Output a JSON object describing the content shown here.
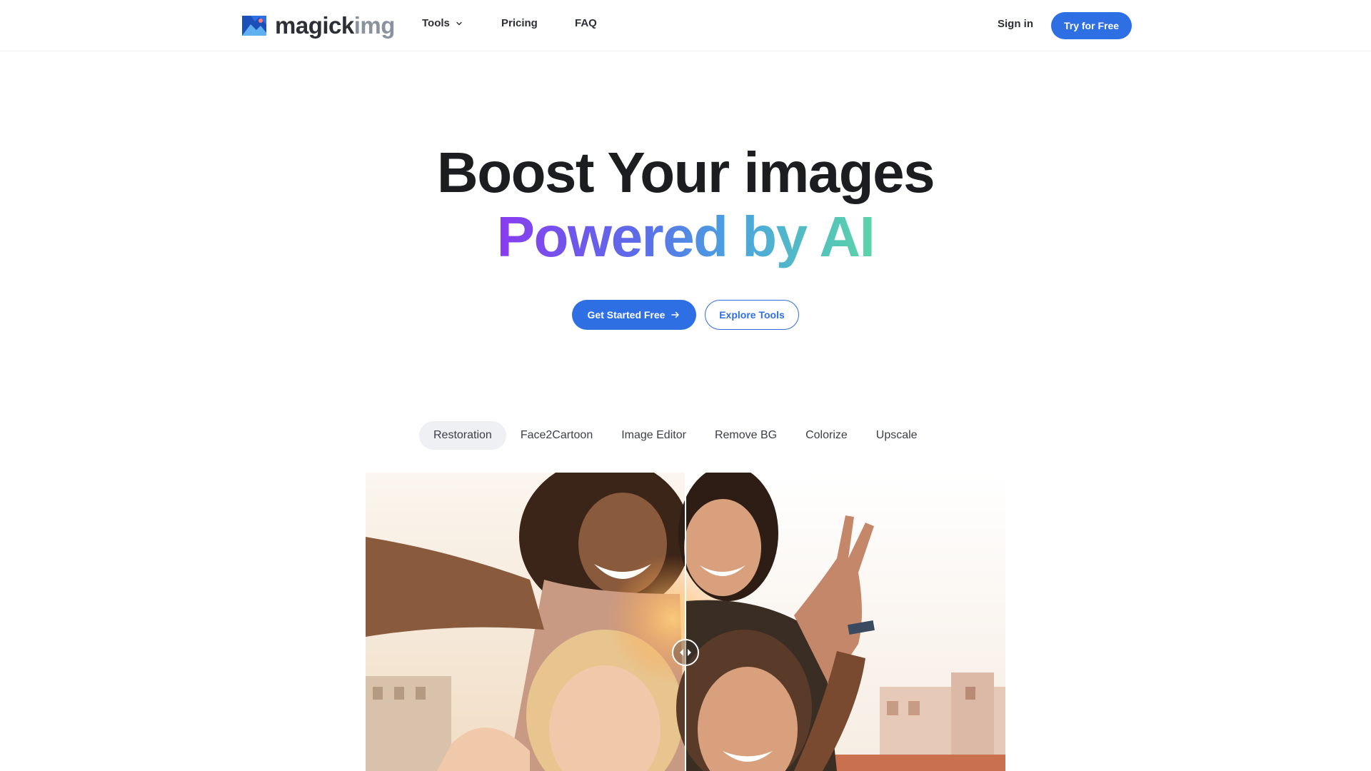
{
  "header": {
    "logo": {
      "brand_dark": "magick",
      "brand_light": "img",
      "icon": "mountain-flag-logo-icon"
    },
    "nav": [
      {
        "label": "Tools",
        "has_dropdown": true
      },
      {
        "label": "Pricing"
      },
      {
        "label": "FAQ"
      }
    ],
    "sign_in": "Sign in",
    "try_button": "Try for Free"
  },
  "hero": {
    "line1": "Boost Your images",
    "line2": "Powered by AI",
    "primary_cta": "Get Started Free",
    "primary_cta_icon": "arrow-right-icon",
    "secondary_cta": "Explore Tools"
  },
  "tabs": {
    "items": [
      "Restoration",
      "Face2Cartoon",
      "Image Editor",
      "Remove BG",
      "Colorize",
      "Upscale"
    ],
    "active": "Restoration"
  },
  "comparison": {
    "slider_position": 0.5,
    "handle_icon": "left-right-arrows-icon"
  },
  "colors": {
    "accent": "#2f6fe4",
    "gradient_start": "#8a3cf0",
    "gradient_mid": "#4aa3e0",
    "gradient_end": "#5cd4a8"
  }
}
